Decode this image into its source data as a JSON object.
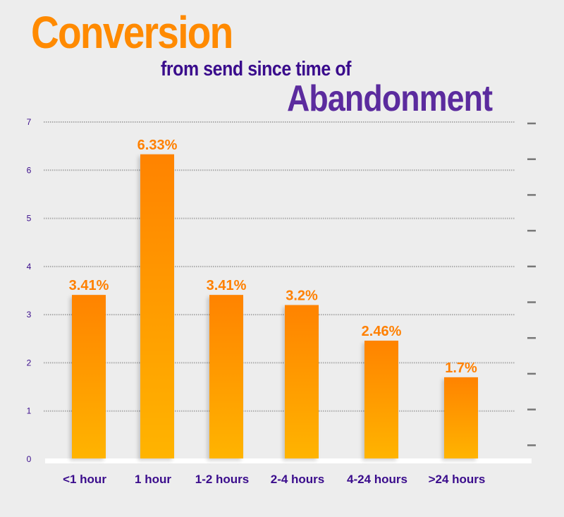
{
  "header": {
    "title": "Conversion",
    "subtitle": "from send since time of",
    "title2": "Abandonment"
  },
  "colors": {
    "title": "#ff8a00",
    "subtitle": "#3a0c8c",
    "title2": "#5b2b9e",
    "bar_top": "#ff8300",
    "bar_bottom": "#ffb400",
    "value_label": "#ff8000",
    "axis_label": "#3a0c8c",
    "grid": "#aaaaaa",
    "background": "#ededed"
  },
  "chart_data": {
    "type": "bar",
    "title": "Conversion from send since time of Abandonment",
    "xlabel": "",
    "ylabel": "",
    "categories": [
      "<1 hour",
      "1 hour",
      "1-2 hours",
      "2-4 hours",
      "4-24 hours",
      ">24 hours"
    ],
    "values": [
      3.41,
      6.33,
      3.41,
      3.2,
      2.46,
      1.7
    ],
    "value_labels": [
      "3.41%",
      "6.33%",
      "3.41%",
      "3.2%",
      "2.46%",
      "1.7%"
    ],
    "yticks": [
      "0",
      "1",
      "2",
      "3",
      "4",
      "5",
      "6",
      "7"
    ],
    "ylim": [
      0,
      7
    ],
    "grid": true,
    "legend": "none"
  }
}
